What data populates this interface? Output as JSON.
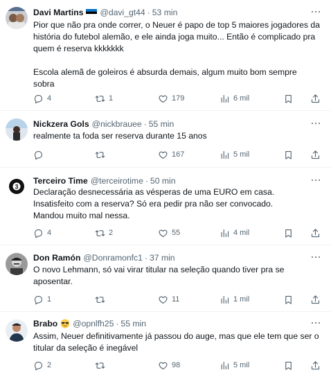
{
  "tweets": [
    {
      "name": "Davi Martins",
      "handle": "@davi_gt44",
      "separator": "·",
      "time": "53 min",
      "flag": "estonia-flag-emoji",
      "lines": [
        "Pior que não pra onde correr, o Neuer é papo de top 5 maiores jogadores da",
        "história do futebol alemão, e ele ainda joga muito... Então é complicado pra",
        "quem é reserva kkkkkkk",
        "Escola alemã de goleiros é absurda demais, algum muito bom sempre",
        "sobra"
      ],
      "replies": "4",
      "retweets": "1",
      "likes": "179",
      "views": "6 mil"
    },
    {
      "name": "Nickzera Gols",
      "handle": "@nickbrauee",
      "separator": "·",
      "time": "55 min",
      "lines": [
        "realmente ta foda ser reserva durante 15 anos"
      ],
      "replies": "",
      "retweets": "",
      "likes": "167",
      "views": "5 mil"
    },
    {
      "name": "Terceiro Time",
      "handle": "@terceirotime",
      "separator": "·",
      "time": "50 min",
      "lines": [
        "Declaração desnecessária as vésperas de uma EURO em casa.",
        "Insatisfeito com a reserva? Só era pedir pra não ser convocado.",
        "Mandou muito mal nessa."
      ],
      "replies": "4",
      "retweets": "2",
      "likes": "55",
      "views": "4 mil"
    },
    {
      "name": "Don Ramón",
      "handle": "@Donramonfc1",
      "separator": "·",
      "time": "37 min",
      "lines": [
        "O novo Lehmann, só vai virar titular na seleção quando tiver pra se",
        "aposentar."
      ],
      "replies": "1",
      "retweets": "",
      "likes": "11",
      "views": "1 mil"
    },
    {
      "name": "Brabo",
      "handle": "@opnlfh25",
      "separator": "·",
      "time": "55 min",
      "emoji": "sunglasses-emoji",
      "lines": [
        "Assim, Neuer definitivamente já passou do auge, mas que ele tem que ser o",
        "titular da seleção é inegável"
      ],
      "replies": "2",
      "retweets": "",
      "likes": "98",
      "views": "5 mil"
    }
  ],
  "icons": {
    "reply": "reply-icon",
    "retweet": "retweet-icon",
    "like": "heart-icon",
    "views": "views-icon",
    "bookmark": "bookmark-icon",
    "share": "share-icon",
    "more": "more-icon"
  },
  "colors": {
    "text": "#0f1419",
    "secondary": "#536471",
    "divider": "#eff3f4"
  }
}
